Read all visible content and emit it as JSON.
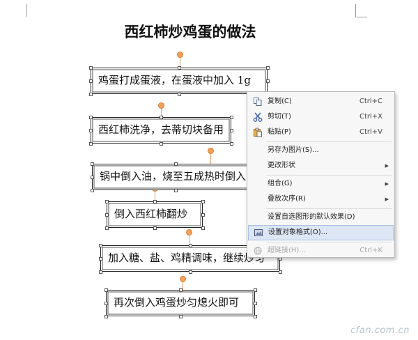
{
  "document": {
    "title": "西红柿炒鸡蛋的做法"
  },
  "steps": [
    "鸡蛋打成蛋液，在蛋液中加入 1g",
    "西红柿洗净，去蒂切块备用",
    "锅中倒入油，烧至五成热时倒入",
    "倒入西红柿翻炒",
    "加入糖、盐、鸡精调味，继续炒匀",
    "再次倒入鸡蛋炒匀熄火即可"
  ],
  "context_menu": {
    "items": [
      {
        "label": "复制(C)",
        "shortcut": "Ctrl+C",
        "icon": "copy-icon"
      },
      {
        "label": "剪切(T)",
        "shortcut": "Ctrl+X",
        "icon": "scissors-icon"
      },
      {
        "label": "粘贴(P)",
        "shortcut": "Ctrl+V",
        "icon": "paste-icon"
      },
      {
        "label": "另存为图片(S)..."
      },
      {
        "label": "更改形状",
        "submenu": true
      },
      {
        "label": "组合(G)",
        "submenu": true
      },
      {
        "label": "叠放次序(R)",
        "submenu": true
      },
      {
        "label": "设置自选图形的默认效果(D)"
      },
      {
        "label": "设置对象格式(O)...",
        "icon": "format-object-icon",
        "highlighted": true
      },
      {
        "label": "超链接(H)...",
        "shortcut": "Ctrl+K",
        "icon": "hyperlink-icon",
        "disabled": true
      }
    ]
  },
  "watermark": "cfan.com.cn",
  "colors": {
    "connector_knob": "#f6a25a",
    "menu_highlight": "#dce6f4"
  }
}
